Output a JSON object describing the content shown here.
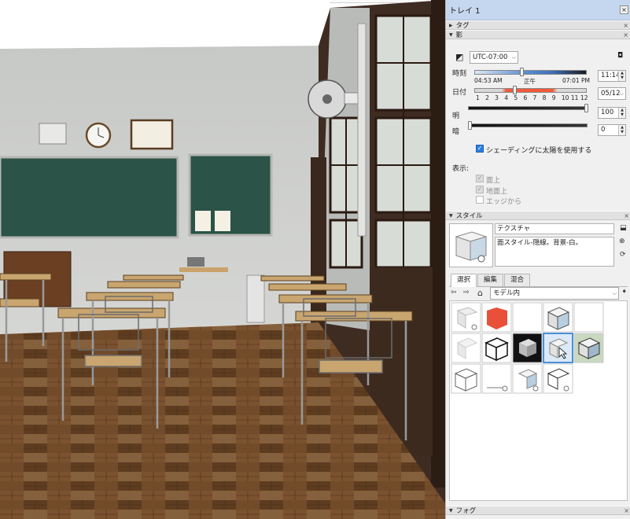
{
  "tray": {
    "title": "トレイ 1",
    "sections": {
      "tags": "タグ",
      "shadows": "影",
      "styles": "スタイル",
      "fog": "フォグ"
    },
    "shadows": {
      "timezone": "UTC-07:00",
      "time_label": "時刻",
      "time_start": "04:53 AM",
      "time_noon": "正午",
      "time_end": "07:01 PM",
      "time_value": "11:14",
      "date_label": "日付",
      "months": [
        "1",
        "2",
        "3",
        "4",
        "5",
        "6",
        "7",
        "8",
        "9",
        "10",
        "11",
        "12"
      ],
      "date_value": "05/12",
      "light_label": "明",
      "light_value": "100",
      "dark_label": "暗",
      "dark_value": "0",
      "use_sun_label": "シェーディングに太陽を使用する",
      "use_sun_checked": true,
      "display_label": "表示:",
      "on_faces": "面上",
      "on_ground": "地面上",
      "from_edges": "エッジから",
      "time_fraction": 0.42,
      "date_fraction": 0.36
    },
    "styles": {
      "style_name": "テクスチャ",
      "style_desc": "面スタイル-隠線。背景-白。",
      "tabs": [
        "選択",
        "編集",
        "混合"
      ],
      "active_tab": "選択",
      "collection": "モデル内"
    }
  },
  "colors": {
    "tray_title_bg": "#c4d7ee",
    "accent_blue": "#2a7de1",
    "date_bar_red": "#f05a3a",
    "time_bar_blue": "#5b8fd6",
    "chalkboard": "#2b5347",
    "wall": "#cfd1cf",
    "floor": "#6a4526"
  }
}
